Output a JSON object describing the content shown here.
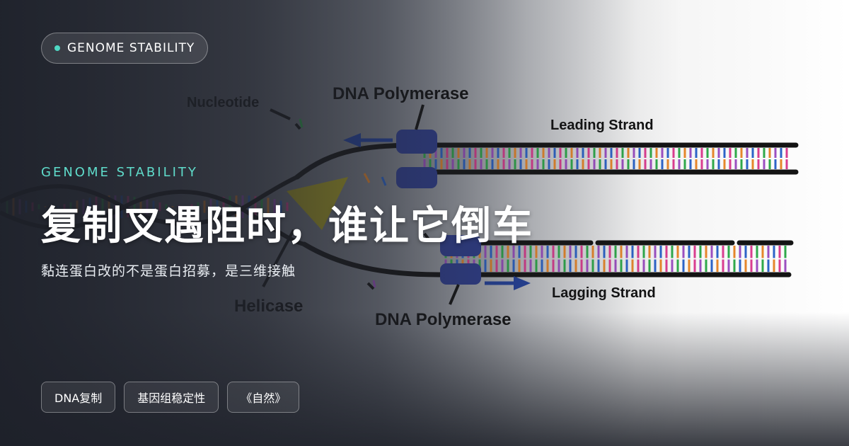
{
  "badge": {
    "label": "GENOME STABILITY",
    "dot_color": "#4fd8c4"
  },
  "kicker": "GENOME STABILITY",
  "title": "复制叉遇阻时，谁让它倒车",
  "subtitle": "黏连蛋白改的不是蛋白招募，是三维接触",
  "tags": [
    "DNA复制",
    "基因组稳定性",
    "《自然》"
  ],
  "diagram": {
    "labels": {
      "nucleotide": "Nucleotide",
      "polymerase_top": "DNA Polymerase",
      "leading": "Leading Strand",
      "helicase": "Helicase",
      "polymerase_bottom": "DNA Polymerase",
      "lagging": "Lagging Strand"
    },
    "colors": {
      "backbone": "#141414",
      "polymerase": "#2f3e8f",
      "helicase": "#b5a814",
      "arrow": "#23419b",
      "bases": [
        "#2fa84a",
        "#e5862b",
        "#9b4fc0",
        "#2c63c7",
        "#d93d8f"
      ]
    }
  }
}
